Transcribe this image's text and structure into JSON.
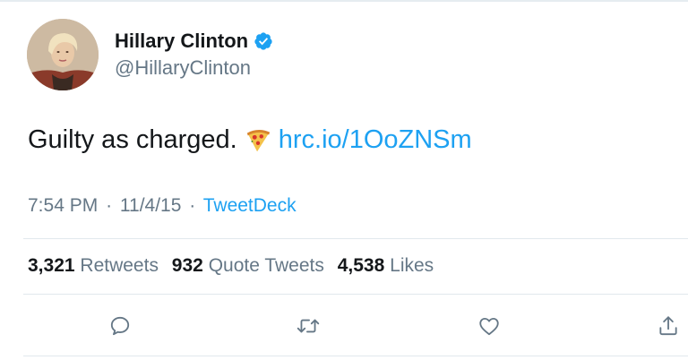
{
  "user": {
    "display_name": "Hillary Clinton",
    "handle": "@HillaryClinton",
    "verified": true,
    "avatar_icon": "profile-photo"
  },
  "tweet": {
    "text": "Guilty as charged.",
    "emoji": "pizza",
    "link": "hrc.io/1OoZNSm"
  },
  "meta": {
    "time": "7:54 PM",
    "separator": "·",
    "date": "11/4/15",
    "source": "TweetDeck"
  },
  "stats": {
    "retweets_count": "3,321",
    "retweets_label": "Retweets",
    "quotes_count": "932",
    "quotes_label": "Quote Tweets",
    "likes_count": "4,538",
    "likes_label": "Likes"
  },
  "actions": [
    "reply-icon",
    "retweet-icon",
    "like-icon",
    "share-icon"
  ],
  "colors": {
    "link": "#1da1f2",
    "secondary_text": "#657786",
    "primary_text": "#14171a",
    "divider": "#e1e8ed"
  }
}
